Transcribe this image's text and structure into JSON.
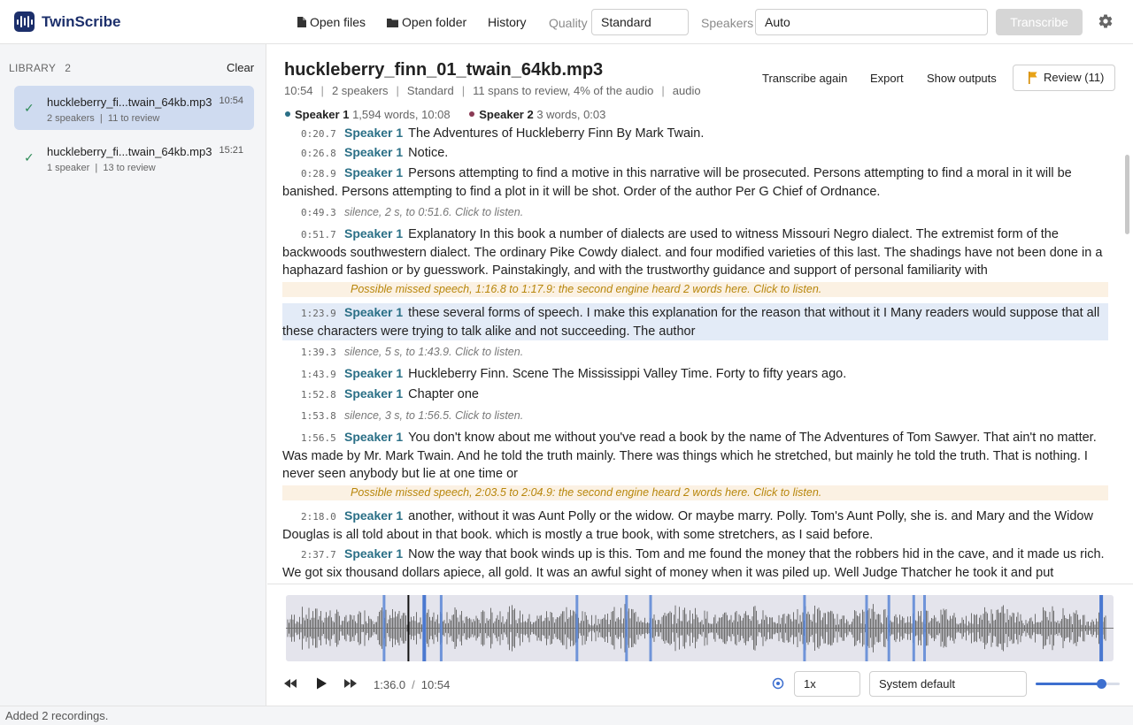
{
  "app": {
    "name": "TwinScribe"
  },
  "toolbar": {
    "open_files": "Open files",
    "open_folder": "Open folder",
    "history": "History",
    "quality_label": "Quality",
    "quality_value": "Standard",
    "speakers_label": "Speakers",
    "speakers_value": "Auto",
    "transcribe": "Transcribe"
  },
  "library": {
    "title": "LIBRARY",
    "count": "2",
    "clear": "Clear",
    "items": [
      {
        "name": "huckleberry_fi...twain_64kb.mp3",
        "time": "10:54",
        "meta": "2 speakers  |  11 to review",
        "active": true
      },
      {
        "name": "huckleberry_fi...twain_64kb.mp3",
        "time": "15:21",
        "meta": "1 speaker  |  13 to review",
        "active": false
      }
    ]
  },
  "main": {
    "title": "huckleberry_finn_01_twain_64kb.mp3",
    "meta": [
      "10:54",
      "2 speakers",
      "Standard",
      "11 spans to review, 4% of the audio",
      "audio"
    ],
    "speakers": [
      {
        "name": "Speaker 1",
        "stat": "1,594 words, 10:08",
        "color": "#2a6f86"
      },
      {
        "name": "Speaker 2",
        "stat": "3 words, 0:03",
        "color": "#8a3a54"
      }
    ],
    "actions": {
      "transcribe_again": "Transcribe again",
      "export": "Export",
      "show_outputs": "Show outputs",
      "review": "Review (11)"
    }
  },
  "transcript": [
    {
      "type": "seg",
      "ts": "0:20.7",
      "speaker": "Speaker 1",
      "text": "The Adventures of Huckleberry Finn By Mark Twain."
    },
    {
      "type": "seg",
      "ts": "0:26.8",
      "speaker": "Speaker 1",
      "text": "Notice."
    },
    {
      "type": "seg",
      "ts": "0:28.9",
      "speaker": "Speaker 1",
      "text": "Persons attempting to find a motive in this narrative will be prosecuted. Persons attempting to find a moral in it will be banished. Persons attempting to find a plot in it will be shot. Order of the author Per G Chief of Ordnance."
    },
    {
      "type": "silence",
      "ts": "0:49.3",
      "text": "silence, 2 s, to 0:51.6. Click to listen."
    },
    {
      "type": "seg",
      "ts": "0:51.7",
      "speaker": "Speaker 1",
      "text": "Explanatory In this book a number of dialects are used to witness Missouri Negro dialect. The extremist form of the backwoods southwestern dialect. The ordinary Pike Cowdy dialect. and four modified varieties of this last. The shadings have not been done in a haphazard fashion or by guesswork. Painstakingly, and with the trustworthy guidance and support of personal familiarity with"
    },
    {
      "type": "warn",
      "text": "Possible missed speech, 1:16.8 to 1:17.9: the second engine heard 2 words here. Click to listen."
    },
    {
      "type": "seg",
      "ts": "1:23.9",
      "speaker": "Speaker 1",
      "text": "these several forms of speech. I make this explanation for the reason that without it I Many readers would suppose that all these characters were trying to talk alike and not succeeding. The author",
      "selected": true
    },
    {
      "type": "silence",
      "ts": "1:39.3",
      "text": "silence, 5 s, to 1:43.9. Click to listen."
    },
    {
      "type": "seg",
      "ts": "1:43.9",
      "speaker": "Speaker 1",
      "text": "Huckleberry Finn. Scene The Mississippi Valley Time. Forty to fifty years ago."
    },
    {
      "type": "seg",
      "ts": "1:52.8",
      "speaker": "Speaker 1",
      "text": "Chapter one"
    },
    {
      "type": "silence",
      "ts": "1:53.8",
      "text": "silence, 3 s, to 1:56.5. Click to listen."
    },
    {
      "type": "seg",
      "ts": "1:56.5",
      "speaker": "Speaker 1",
      "text": "You don't know about me without you've read a book by the name of The Adventures of Tom Sawyer. That ain't no matter. Was made by Mr. Mark Twain. And he told the truth mainly. There was things which he stretched, but mainly he told the truth. That is nothing. I never seen anybody but lie at one time or"
    },
    {
      "type": "warn",
      "text": "Possible missed speech, 2:03.5 to 2:04.9: the second engine heard 2 words here. Click to listen."
    },
    {
      "type": "seg",
      "ts": "2:18.0",
      "speaker": "Speaker 1",
      "text": "another, without it was Aunt Polly or the widow. Or maybe marry. Polly. Tom's Aunt Polly, she is. and Mary and the Widow Douglas is all told about in that book. which is mostly a true book, with some stretchers, as I said before."
    },
    {
      "type": "seg",
      "ts": "2:37.7",
      "speaker": "Speaker 1",
      "text": "Now the way that book winds up is this. Tom and me found the money that the robbers hid in the cave, and it made us rich. We got six thousand dollars apiece, all gold. It was an awful sight of money when it was piled up. Well Judge Thatcher he took it and put"
    }
  ],
  "player": {
    "current": "1:36.0",
    "duration": "10:54",
    "rate": "1x",
    "output": "System default",
    "volume": 0.78,
    "playhead_fraction": 0.147,
    "review_markers": [
      0.117,
      0.186,
      0.35,
      0.41,
      0.439,
      0.625,
      0.7,
      0.727,
      0.757,
      0.77
    ],
    "sel_markers": [
      0.165,
      0.983
    ]
  },
  "status": "Added 2 recordings.",
  "colors": {
    "accent": "#3d6fcf",
    "brand": "#1c2f6b",
    "speaker": "#2a6f86",
    "warn_bg": "#fbf1e3",
    "warn_text": "#b8860b"
  }
}
